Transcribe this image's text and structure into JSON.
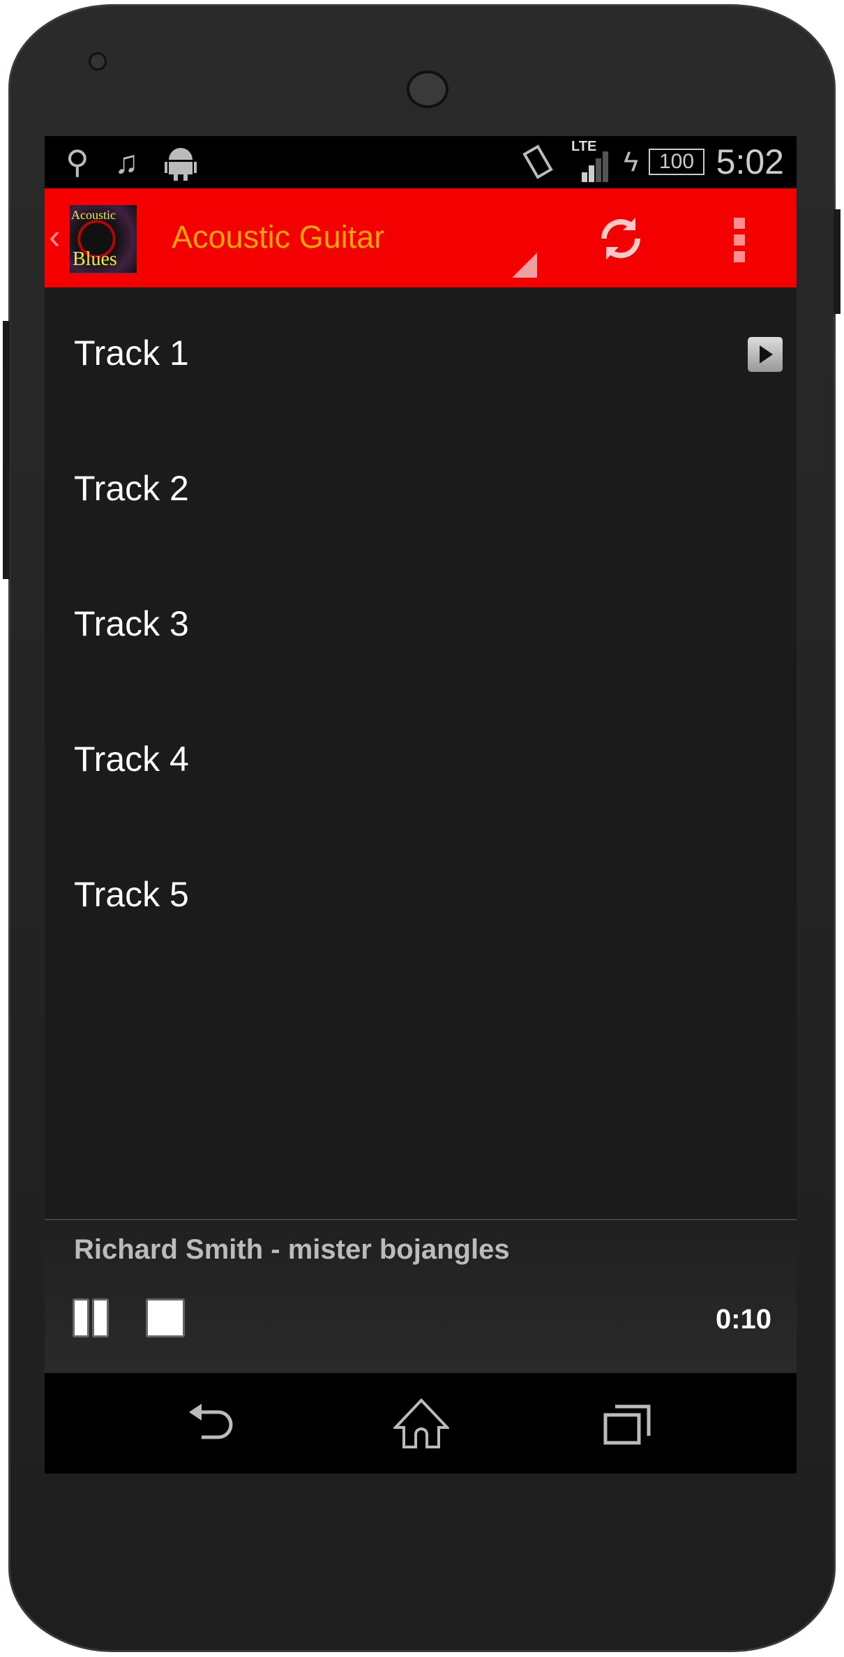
{
  "status_bar": {
    "time": "5:02",
    "battery": "100",
    "network": "LTE",
    "icons": [
      "usb-icon",
      "music-note-icon",
      "android-icon",
      "vibrate-icon",
      "signal-icon",
      "charging-icon",
      "battery-icon"
    ]
  },
  "action_bar": {
    "title": "Acoustic Guitar",
    "logo_text": [
      "Acoustic",
      "Blues"
    ],
    "background": "#f50000",
    "title_color": "#ffa500",
    "icons": [
      "back-chevron-icon",
      "refresh-icon",
      "overflow-menu-icon"
    ]
  },
  "tracks": [
    {
      "label": "Track 1",
      "playing": true
    },
    {
      "label": "Track 2"
    },
    {
      "label": "Track 3"
    },
    {
      "label": "Track 4"
    },
    {
      "label": "Track 5"
    }
  ],
  "player": {
    "now_playing": "Richard Smith - mister bojangles",
    "elapsed": "0:10",
    "icons": [
      "pause-icon",
      "stop-icon"
    ]
  },
  "nav_bar": {
    "icons": [
      "back-icon",
      "home-icon",
      "recents-icon"
    ]
  }
}
